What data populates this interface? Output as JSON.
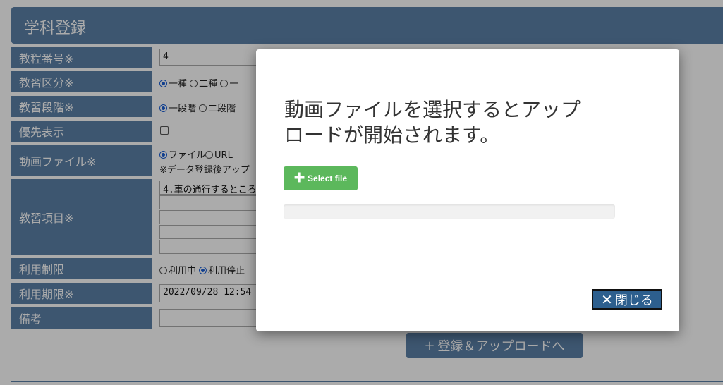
{
  "header": {
    "title": "学科登録"
  },
  "form": {
    "rows": [
      {
        "label": "教程番号※"
      },
      {
        "label": "教習区分※"
      },
      {
        "label": "教習段階※"
      },
      {
        "label": "優先表示"
      },
      {
        "label": "動画ファイル※"
      },
      {
        "label": "教習項目※"
      },
      {
        "label": "利用制限"
      },
      {
        "label": "利用期限※"
      },
      {
        "label": "備考"
      }
    ],
    "course_number": "4",
    "category_options": [
      "一種",
      "二種",
      "一"
    ],
    "category_selected": "一種",
    "stage_options": [
      "一段階",
      "二段階"
    ],
    "stage_selected": "一段階",
    "priority_checked": false,
    "video_options": [
      "ファイル",
      "URL"
    ],
    "video_selected": "ファイル",
    "video_note": "※データ登録後アップ",
    "items": [
      "4.車の通行するところ",
      "",
      "",
      "",
      ""
    ],
    "usage_options": [
      "利用中",
      "利用停止"
    ],
    "usage_selected": "利用停止",
    "expiry": "2022/09/28 12:54",
    "remarks": ""
  },
  "submit_button": {
    "label": "登録＆アップロードへ",
    "icon": "plus-icon"
  },
  "modal": {
    "message": "動画ファイルを選択するとアップロードが開始されます。",
    "message_line1": "動画ファイルを選択するとアップ",
    "message_line2": "ロードが開始されます。",
    "select_file_label": "Select file",
    "select_file_icon": "plus-icon",
    "progress": 0,
    "close_label": "閉じる",
    "close_icon": "close-icon"
  },
  "colors": {
    "accent": "#5b80a8",
    "success": "#5cb85c",
    "close_button": "#2d5f8e"
  }
}
